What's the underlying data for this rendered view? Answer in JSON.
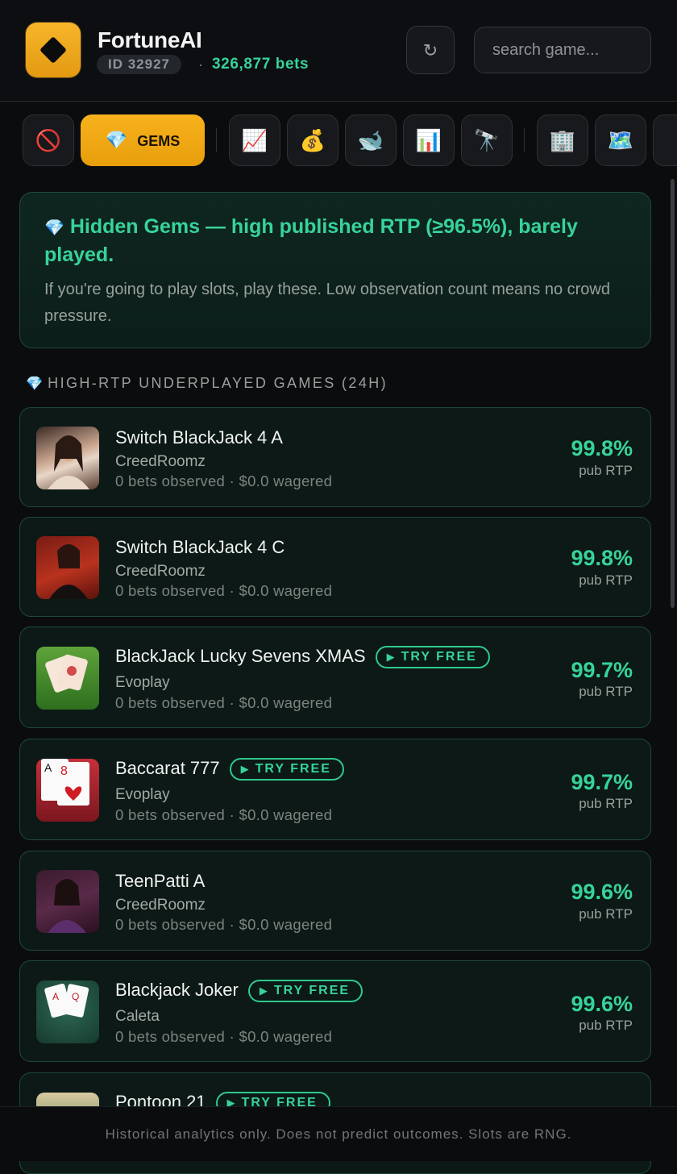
{
  "header": {
    "app_title": "FortuneAI",
    "user_id": "ID 32927",
    "separator": "·",
    "bets_count": "326,877 bets",
    "refresh_icon": "↻",
    "search_placeholder": "search game..."
  },
  "filters": {
    "active_label": "GEMS",
    "icons": [
      "no-entry-icon",
      "gem-icon",
      "chart-increasing-icon",
      "money-bag-icon",
      "whale-icon",
      "bar-chart-icon",
      "telescope-icon",
      "office-building-icon",
      "map-icon",
      "partial-icon"
    ],
    "glyphs": {
      "no_entry": "🚫",
      "gem": "💎",
      "chart_up": "📈",
      "money_bag": "💰",
      "whale": "🐋",
      "bar_chart": "📊",
      "telescope": "🔭",
      "building": "🏢",
      "map": "🗺️"
    }
  },
  "info": {
    "gem_glyph": "💎",
    "title": "Hidden Gems — high published RTP (≥96.5%), barely played.",
    "description": "If you're going to play slots, play these. Low observation count means no crowd pressure."
  },
  "section": {
    "gem_glyph": "💎",
    "heading": "HIGH-RTP UNDERPLAYED GAMES (24H)"
  },
  "try_free_label": "TRY FREE",
  "try_free_icon": "▶",
  "rtp_label": "pub RTP",
  "games": [
    {
      "name": "Switch BlackJack 4 A",
      "provider": "CreedRoomz",
      "stats": "0 bets observed · $0.0 wagered",
      "rtp": "99.8%",
      "try_free": false
    },
    {
      "name": "Switch BlackJack 4 C",
      "provider": "CreedRoomz",
      "stats": "0 bets observed · $0.0 wagered",
      "rtp": "99.8%",
      "try_free": false
    },
    {
      "name": "BlackJack Lucky Sevens XMAS",
      "provider": "Evoplay",
      "stats": "0 bets observed · $0.0 wagered",
      "rtp": "99.7%",
      "try_free": true
    },
    {
      "name": "Baccarat 777",
      "provider": "Evoplay",
      "stats": "0 bets observed · $0.0 wagered",
      "rtp": "99.7%",
      "try_free": true
    },
    {
      "name": "TeenPatti A",
      "provider": "CreedRoomz",
      "stats": "0 bets observed · $0.0 wagered",
      "rtp": "99.6%",
      "try_free": false
    },
    {
      "name": "Blackjack Joker",
      "provider": "Caleta",
      "stats": "0 bets observed · $0.0 wagered",
      "rtp": "99.6%",
      "try_free": true
    },
    {
      "name": "Pontoon 21",
      "provider": "",
      "stats": "",
      "rtp": "",
      "try_free": true
    }
  ],
  "footer": {
    "disclaimer": "Historical analytics only. Does not predict outcomes. Slots are RNG."
  },
  "colors": {
    "accent": "#37d39a",
    "brand": "#f7b21c",
    "background": "#0b0c0e",
    "card_border": "#1f4a3a"
  }
}
